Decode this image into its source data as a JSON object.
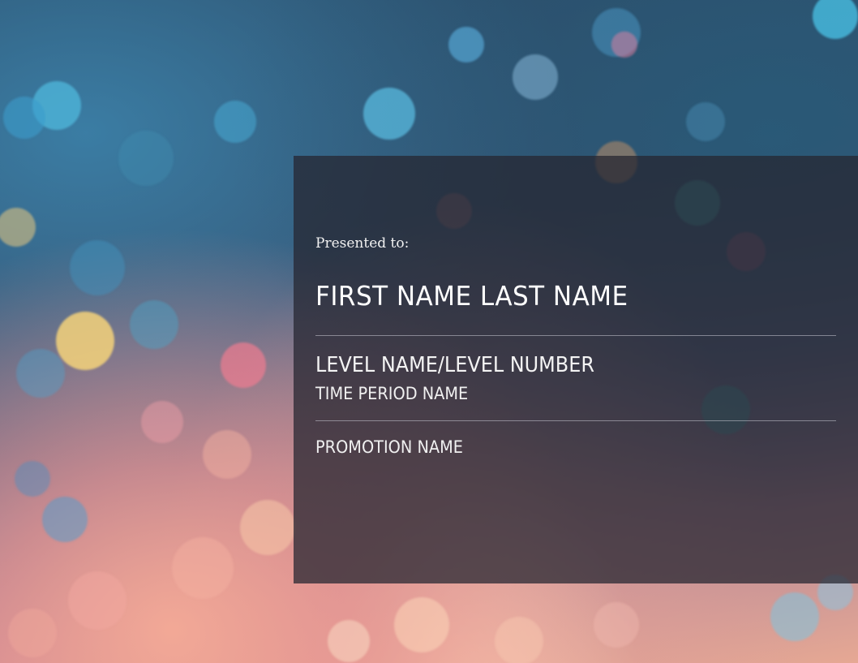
{
  "certificate": {
    "presented_label": "Presented to:",
    "recipient_name": "FIRST NAME LAST NAME",
    "level": "LEVEL NAME/LEVEL NUMBER",
    "time_period": "TIME PERIOD NAME",
    "promotion": "PROMOTION NAME"
  },
  "colors": {
    "panel_overlay": "#262630",
    "text": "#ffffff",
    "divider": "#c8c8d2",
    "background_blue": "#2a4a66",
    "background_peach": "#e6a894"
  }
}
